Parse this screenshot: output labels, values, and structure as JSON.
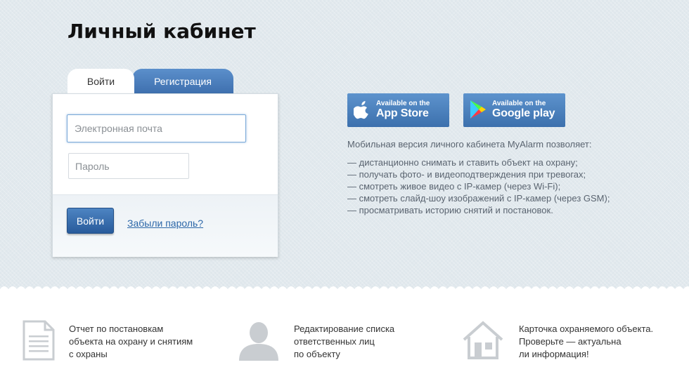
{
  "page_title": "Личный кабинет",
  "tabs": {
    "login": "Войти",
    "register": "Регистрация"
  },
  "login_form": {
    "email_placeholder": "Электронная почта",
    "password_placeholder": "Пароль",
    "submit_label": "Войти",
    "forgot_link": "Забыли пароль?"
  },
  "store_badges": {
    "app_store": {
      "small": "Available on the",
      "big": "App Store",
      "icon": "apple-icon"
    },
    "google_play": {
      "small": "Available on the",
      "big": "Google play",
      "icon": "google-play-icon"
    }
  },
  "mobile_info": {
    "intro": "Мобильная версия личного кабинета MyAlarm позволяет:",
    "items": [
      "— дистанционно снимать и ставить объект на охрану;",
      "— получать фото- и видеоподтверждения при тревогах;",
      "— смотреть живое видео с IP-камер (через Wi-Fi);",
      "— смотреть слайд-шоу изображений с IP-камер (через GSM);",
      "— просматривать историю снятий и постановок."
    ]
  },
  "features": [
    {
      "icon": "document-icon",
      "lines": [
        "Отчет по постановкам",
        "объекта на охрану и снятиям",
        "с охраны"
      ]
    },
    {
      "icon": "user-icon",
      "lines": [
        "Редактирование списка",
        "ответственных лиц",
        "по объекту"
      ]
    },
    {
      "icon": "house-icon",
      "lines": [
        "Карточка охраняемого объекта.",
        "Проверьте — актуальна",
        "ли информация!"
      ]
    }
  ],
  "colors": {
    "accent": "#3e6fae",
    "background": "#dfe7ec",
    "link": "#2c67a8"
  }
}
